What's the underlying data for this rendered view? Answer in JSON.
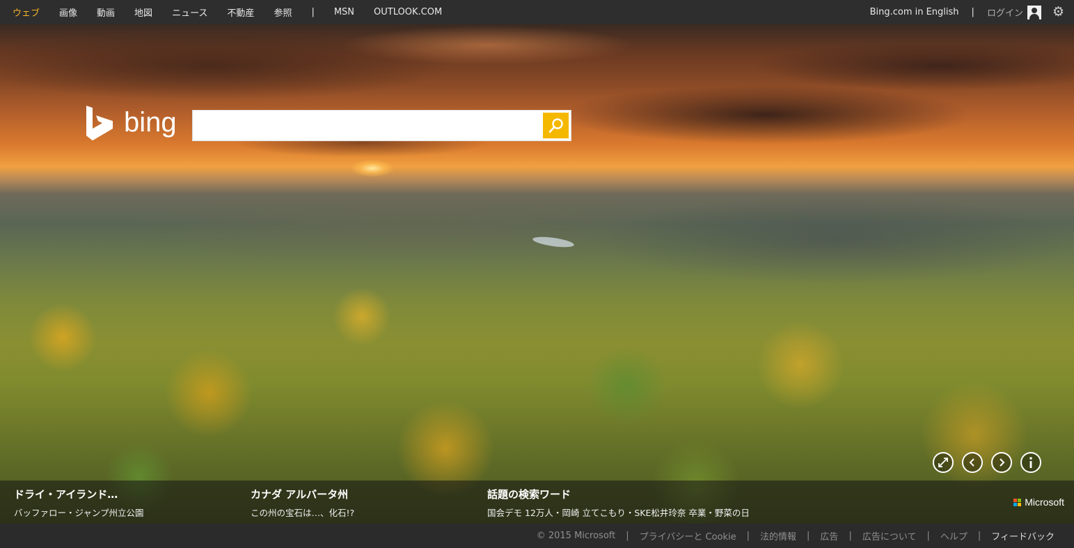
{
  "topnav": {
    "items": [
      "ウェブ",
      "画像",
      "動画",
      "地図",
      "ニュース",
      "不動産",
      "参照"
    ],
    "separator": "|",
    "extra": [
      "MSN",
      "OUTLOOK.COM"
    ],
    "active_color": "#f5b32a"
  },
  "topright": {
    "english": "Bing.com in English",
    "separator": "|",
    "login": "ログイン",
    "user_icon": "user-icon",
    "settings_icon": "gear-icon"
  },
  "logo": {
    "word": "bing"
  },
  "search": {
    "value": "",
    "placeholder": "",
    "button_icon": "search-icon",
    "button_color": "#f5b800"
  },
  "controls": [
    "expand-icon",
    "previous-icon",
    "next-icon",
    "info-icon"
  ],
  "stories": [
    {
      "title": "ドライ・アイランド…",
      "subtitle": "バッファロー・ジャンプ州立公園"
    },
    {
      "title": "カナダ アルバータ州",
      "subtitle": "この州の宝石は…、化石!?"
    },
    {
      "title": "話題の検索ワード",
      "subtitle": "国会デモ 12万人・岡崎 立てこもり・SKE松井玲奈 卒業・野菜の日"
    }
  ],
  "brand": {
    "name": "Microsoft",
    "colors": [
      "#f35325",
      "#81bc06",
      "#05a6f0",
      "#ffba08"
    ]
  },
  "footer": {
    "items": [
      "© 2015 Microsoft",
      "プライバシーと Cookie",
      "法的情報",
      "広告",
      "広告について",
      "ヘルプ",
      "フィードバック"
    ],
    "separator": "|"
  }
}
